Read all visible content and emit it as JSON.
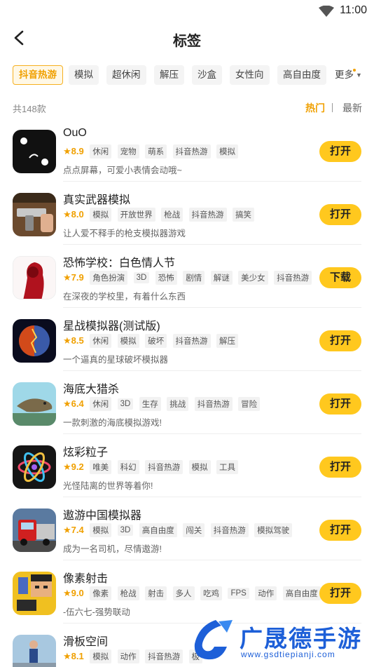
{
  "status_bar": {
    "time": "11:00"
  },
  "header": {
    "title": "标签"
  },
  "tags": [
    {
      "label": "抖音热游",
      "active": true
    },
    {
      "label": "模拟"
    },
    {
      "label": "超休闲"
    },
    {
      "label": "解压"
    },
    {
      "label": "沙盒"
    },
    {
      "label": "女性向"
    },
    {
      "label": "高自由度"
    }
  ],
  "more_label": "更多",
  "count_text": "共148款",
  "sort": {
    "hot": "热门",
    "new": "最新"
  },
  "apps": [
    {
      "name": "OuO",
      "rating": "8.9",
      "tags": [
        "休闲",
        "宠物",
        "萌系",
        "抖音热游",
        "模拟"
      ],
      "desc": "点点屏幕，可爱小表情会动哦~",
      "button": "打开",
      "icon": "ouo-icon"
    },
    {
      "name": "真实武器模拟",
      "rating": "8.0",
      "tags": [
        "模拟",
        "开放世界",
        "枪战",
        "抖音热游",
        "搞笑"
      ],
      "desc": "让人爱不释手的枪支模拟器游戏",
      "button": "打开",
      "icon": "gun-icon"
    },
    {
      "name": "恐怖学校：白色情人节",
      "rating": "7.9",
      "tags": [
        "角色扮演",
        "3D",
        "恐怖",
        "剧情",
        "解谜",
        "美少女",
        "抖音热游"
      ],
      "desc": "在深夜的学校里，有着什么东西",
      "button": "下载",
      "icon": "girl-silhouette-icon"
    },
    {
      "name": "星战模拟器(测试版)",
      "rating": "8.5",
      "tags": [
        "休闲",
        "模拟",
        "破坏",
        "抖音热游",
        "解压"
      ],
      "desc": "一个逼真的星球破坏模拟器",
      "button": "打开",
      "icon": "planet-icon"
    },
    {
      "name": "海底大猎杀",
      "rating": "6.4",
      "tags": [
        "休闲",
        "3D",
        "生存",
        "挑战",
        "抖音热游",
        "冒险"
      ],
      "desc": "一款刺激的海底模拟游戏!",
      "button": "打开",
      "icon": "sea-creature-icon"
    },
    {
      "name": "炫彩粒子",
      "rating": "9.2",
      "tags": [
        "唯美",
        "科幻",
        "抖音热游",
        "模拟",
        "工具"
      ],
      "desc": "光怪陆离的世界等着你!",
      "button": "打开",
      "icon": "atom-icon"
    },
    {
      "name": "遨游中国模拟器",
      "rating": "7.4",
      "tags": [
        "模拟",
        "3D",
        "高自由度",
        "闯关",
        "抖音热游",
        "模拟驾驶"
      ],
      "desc": "成为一名司机，尽情遨游!",
      "button": "打开",
      "icon": "truck-icon"
    },
    {
      "name": "像素射击",
      "rating": "9.0",
      "tags": [
        "像素",
        "枪战",
        "射击",
        "多人",
        "吃鸡",
        "FPS",
        "动作",
        "高自由度"
      ],
      "desc": "-伍六七-强势联动",
      "button": "打开",
      "icon": "pixel-character-icon"
    },
    {
      "name": "滑板空间",
      "rating": "8.1",
      "tags": [
        "模拟",
        "动作",
        "抖音热游",
        "极"
      ],
      "desc": "",
      "button": "",
      "icon": "skateboard-icon"
    }
  ],
  "watermark": {
    "text": "广晟德手游",
    "url": "www.gsdtiepianji.com"
  },
  "colors": {
    "accent": "#f0a000",
    "button": "#ffc81e",
    "watermark": "#1d5fd8"
  }
}
